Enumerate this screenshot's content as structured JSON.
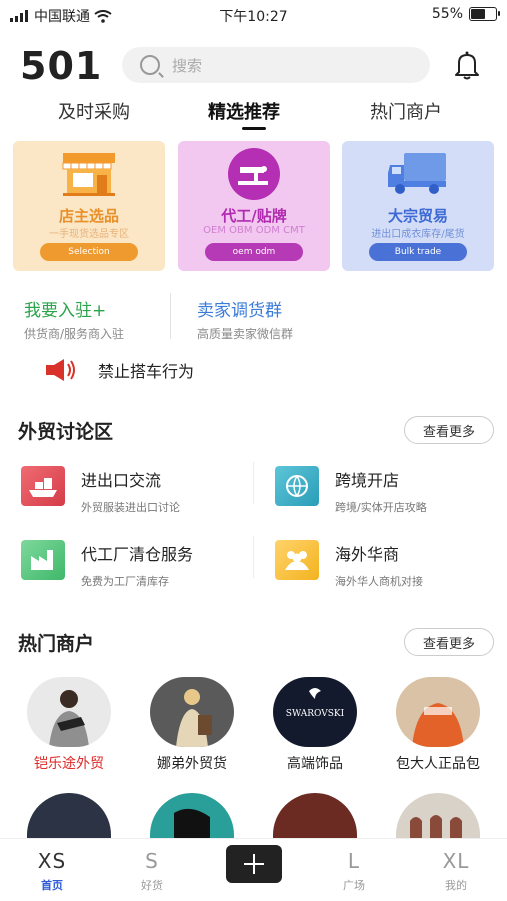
{
  "status": {
    "carrier": "中国联通",
    "time": "下午10:27",
    "battery": "55%"
  },
  "header": {
    "logo": "501",
    "search_placeholder": "搜索"
  },
  "tabs": [
    {
      "label": "及时采购"
    },
    {
      "label": "精选推荐",
      "active": true
    },
    {
      "label": "热门商户"
    }
  ],
  "cards": [
    {
      "title": "店主选品",
      "subtitle": "一手现货选品专区",
      "button": "Selection",
      "color": "#e8902a"
    },
    {
      "title": "代工/贴牌",
      "subtitle": "OEM OBM ODM CMT",
      "button": "oem odm",
      "color": "#b12bb0"
    },
    {
      "title": "大宗贸易",
      "subtitle": "进出口成衣库存/尾货",
      "button": "Bulk trade",
      "color": "#3d69d4"
    }
  ],
  "join": [
    {
      "title": "我要入驻+",
      "subtitle": "供货商/服务商入驻",
      "color": "#2aa44a"
    },
    {
      "title": "卖家调货群",
      "subtitle": "高质量卖家微信群",
      "color": "#3b7bd8"
    }
  ],
  "notice": {
    "text": "禁止搭车行为"
  },
  "forum": {
    "title": "外贸讨论区",
    "more": "查看更多",
    "items": [
      {
        "title": "进出口交流",
        "subtitle": "外贸服装进出口讨论",
        "icon": "cargo-ship-icon"
      },
      {
        "title": "跨境开店",
        "subtitle": "跨境/实体开店攻略",
        "icon": "globe-icon"
      },
      {
        "title": "代工厂清仓服务",
        "subtitle": "免费为工厂清库存",
        "icon": "factory-icon"
      },
      {
        "title": "海外华商",
        "subtitle": "海外华人商机对接",
        "icon": "people-icon"
      }
    ]
  },
  "merchants": {
    "title": "热门商户",
    "more": "查看更多",
    "items": [
      {
        "name": "铠乐途外贸",
        "highlight": true
      },
      {
        "name": "娜弟外贸货"
      },
      {
        "name": "高端饰品",
        "logo_text": "SWAROVSKI"
      },
      {
        "name": "包大人正品包"
      }
    ]
  },
  "bottom_nav": [
    {
      "big": "XS",
      "label": "首页",
      "active": true
    },
    {
      "big": "S",
      "label": "好货"
    },
    {
      "big": "L",
      "label": "广场"
    },
    {
      "big": "XL",
      "label": "我的"
    }
  ]
}
